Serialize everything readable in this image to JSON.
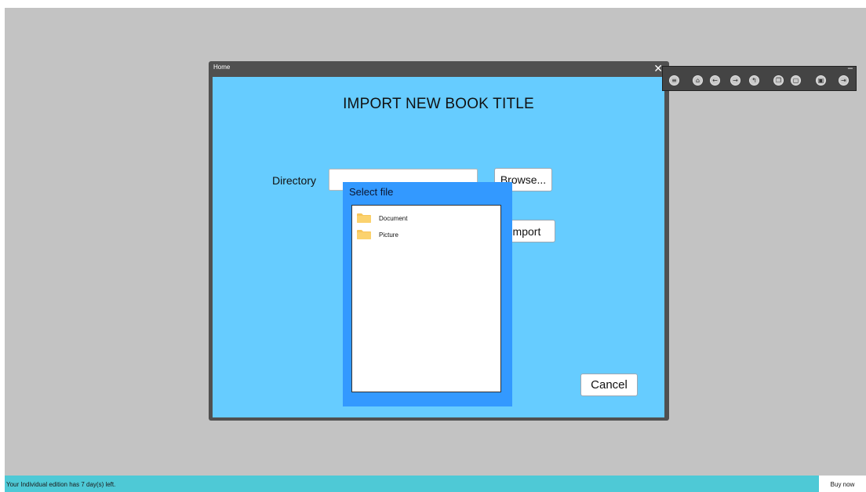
{
  "window": {
    "title": "Home",
    "close_glyph": "✕"
  },
  "import_page": {
    "heading": "IMPORT NEW BOOK TITLE",
    "directory_label": "Directory",
    "directory_value": "",
    "browse_label": "Browse...",
    "import_label": "Import",
    "cancel_label": "Cancel"
  },
  "select_file_dialog": {
    "title": "Select file",
    "items": [
      {
        "label": "Document",
        "icon": "folder-icon"
      },
      {
        "label": "Picture",
        "icon": "folder-icon"
      }
    ]
  },
  "toolbar": {
    "minimize_glyph": "–",
    "icons": [
      "menu-icon",
      "home-icon",
      "back-icon",
      "forward-icon",
      "up-icon",
      "copy-icon",
      "paste-icon",
      "save-icon",
      "exit-icon"
    ]
  },
  "status_bar": {
    "text": "Your Individual edition has 7 day(s) left.",
    "buy_label": "Buy now"
  },
  "colors": {
    "desktop": "#c3c3c3",
    "window_frame": "#505050",
    "window_body": "#66ccff",
    "dialog": "#3399ff",
    "status_bar": "#4ec9d6",
    "folder": "#f7c55a"
  }
}
